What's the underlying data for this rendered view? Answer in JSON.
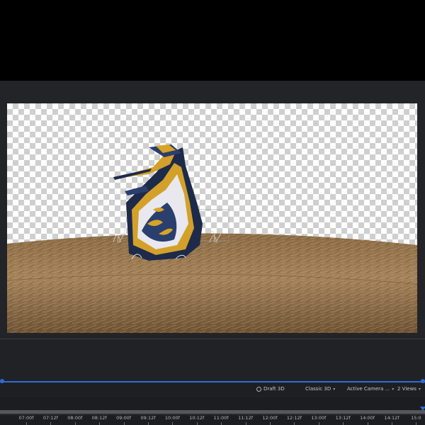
{
  "toolbar": {
    "draft3d_label": "Draft 3D",
    "renderer_label": "Classic 3D",
    "camera_label": "Active Camera ...",
    "views_label": "2 Views",
    "draft_icon": "draft-3d-icon",
    "dropdown_icon": "chevron-down-icon"
  },
  "timeline": {
    "ticks": [
      "07:00f",
      "07:12f",
      "08:00f",
      "08:12f",
      "09:00f",
      "09:12f",
      "10:00f",
      "10:12f",
      "11:00f",
      "11:12f",
      "12:00f",
      "12:12f",
      "13:00f",
      "13:12f",
      "14:00f",
      "14:12f",
      "15:0"
    ]
  },
  "colors": {
    "accent": "#2d6bd6",
    "panel": "#222326",
    "canvas_checker": "#cfcfcf"
  }
}
